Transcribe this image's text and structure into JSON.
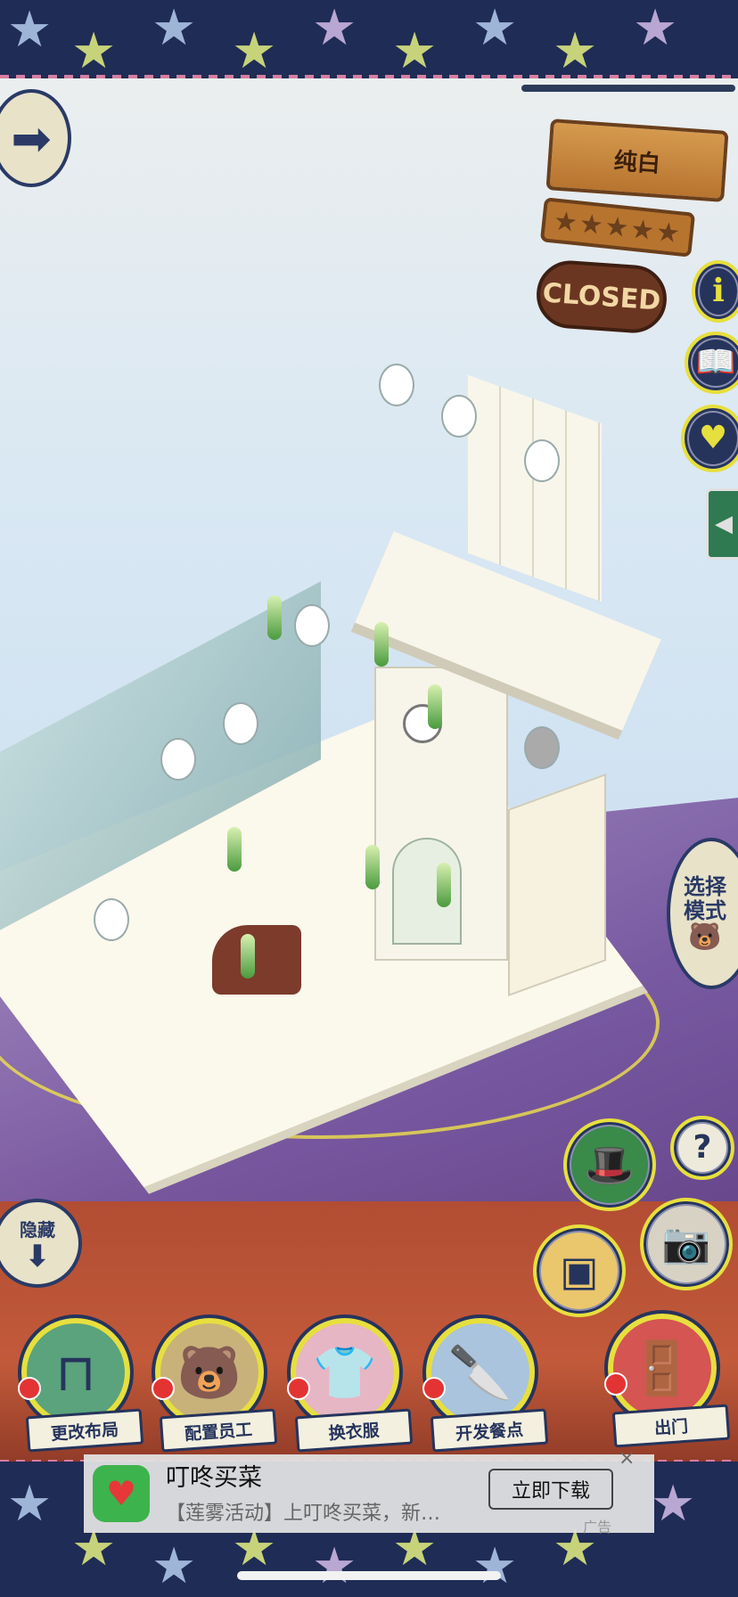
{
  "sign": {
    "name": "纯白",
    "stars": "★★★★★",
    "status": "CLOSED"
  },
  "icons": {
    "next": "arrow-right-icon",
    "info": "info-icon",
    "book": "book-icon",
    "favorite": "heart-icon",
    "collapse": "chevron-left-icon",
    "help": "question-icon",
    "hat": "hat-icon",
    "frame": "picture-icon",
    "camera": "camera-icon"
  },
  "mode_button": {
    "line1": "选择",
    "line2": "模式"
  },
  "hide_button": {
    "label": "隐藏"
  },
  "menu": [
    {
      "label": "更改布局",
      "icon": "table-icon"
    },
    {
      "label": "配置员工",
      "icon": "bear-icon"
    },
    {
      "label": "换衣服",
      "icon": "shirt-icon"
    },
    {
      "label": "开发餐点",
      "icon": "knife-icon"
    },
    {
      "label": "出门",
      "icon": "door-icon"
    }
  ],
  "ad": {
    "title": "叮咚买菜",
    "desc": "【莲雾活动】上叮咚买菜，新…",
    "button": "立即下载",
    "tag": "广告",
    "close": "×"
  },
  "colors": {
    "navy": "#26345c",
    "yellow": "#e7df3d",
    "cream": "#e8e2c9"
  }
}
